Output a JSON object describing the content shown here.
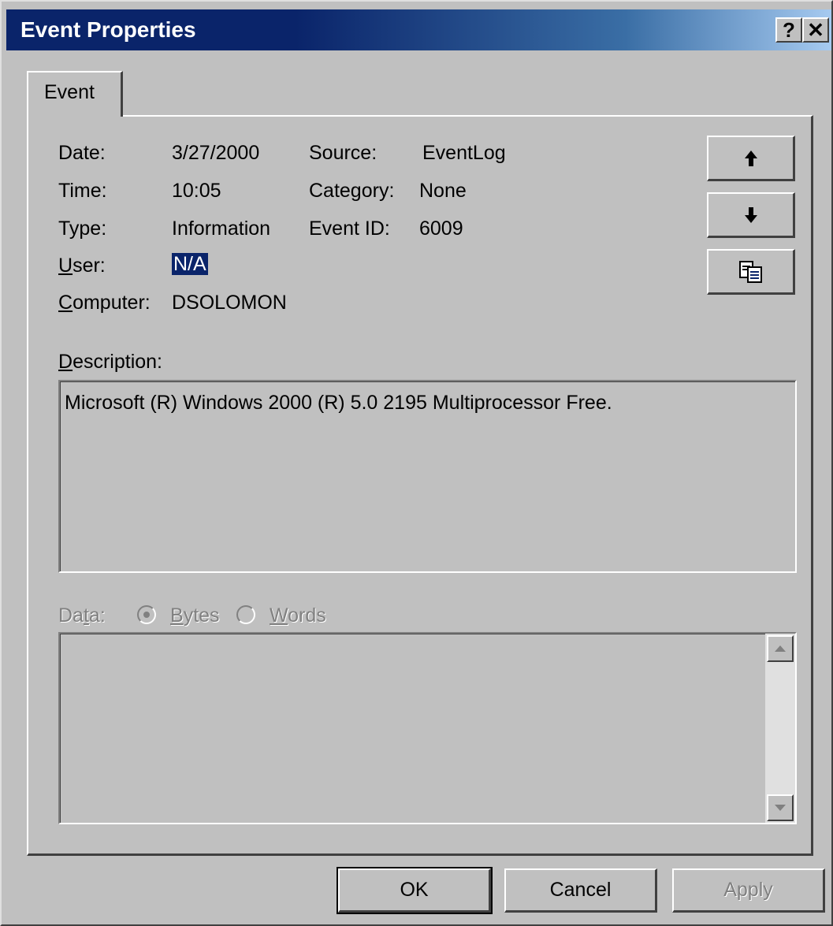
{
  "window": {
    "title": "Event Properties",
    "help_glyph": "?",
    "close_glyph": "✕"
  },
  "tabs": [
    {
      "label": "Event",
      "selected": true
    }
  ],
  "fields": {
    "date_label": "Date:",
    "date_value": "3/27/2000",
    "time_label": "Time:",
    "time_value": "10:05",
    "type_label": "Type:",
    "type_value": "Information",
    "user_label_mnemonic": "U",
    "user_label_rest": "ser:",
    "user_value": "N/A",
    "computer_label_mnemonic": "C",
    "computer_label_rest": "omputer:",
    "computer_value": "DSOLOMON",
    "source_label": "Source:",
    "source_value": "EventLog",
    "category_label": "Category:",
    "category_value": "None",
    "event_id_label": "Event ID:",
    "event_id_value": "6009"
  },
  "side_buttons": [
    {
      "icon": "arrow-up-icon"
    },
    {
      "icon": "arrow-down-icon"
    },
    {
      "icon": "copy-icon"
    }
  ],
  "description": {
    "label_mnemonic": "D",
    "label_rest": "escription:",
    "text": "Microsoft (R) Windows 2000 (R) 5.0 2195  Multiprocessor Free."
  },
  "data_section": {
    "label_pre": "Da",
    "label_mnemonic": "t",
    "label_post": "a:",
    "bytes_mnemonic": "B",
    "bytes_rest": "ytes",
    "words_mnemonic": "W",
    "words_rest": "ords",
    "selected_option": "Bytes",
    "enabled": false
  },
  "buttons": {
    "ok": "OK",
    "cancel": "Cancel",
    "apply": "Apply"
  },
  "colors": {
    "face": "#c0c0c0",
    "titlebar": "#0a246a",
    "selection": "#0a246a",
    "disabled_text": "#808080"
  }
}
